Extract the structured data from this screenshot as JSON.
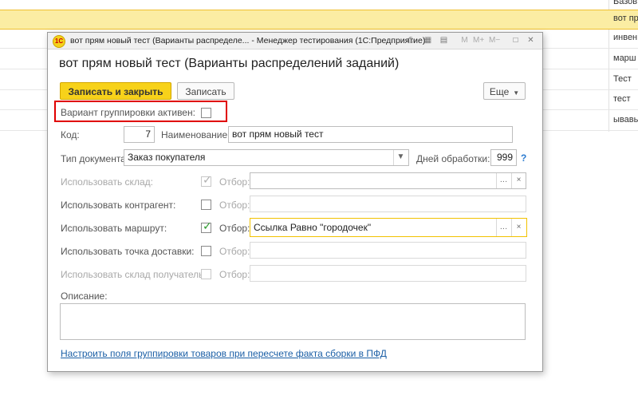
{
  "background_list": {
    "rows": [
      "Базов",
      "вот пр",
      "инвен",
      "марш",
      "Тест",
      "тест",
      "ывавы"
    ]
  },
  "window": {
    "logo_text": "1С",
    "title": "вот прям новый тест (Варианты распределе... - Менеджер тестирования (1С:Предприятие)",
    "form_title": "вот прям новый тест (Варианты распределений заданий)"
  },
  "toolbar": {
    "save_close_label": "Записать и закрыть",
    "save_label": "Записать",
    "more_label": "Еще"
  },
  "form": {
    "grouping_active_label": "Вариант группировки активен:",
    "grouping_active_checked": false,
    "code_label": "Код:",
    "code_value": "7",
    "name_label": "Наименование:",
    "name_value": "вот прям новый тест",
    "doc_type_label": "Тип документа:",
    "doc_type_value": "Заказ покупателя",
    "days_label": "Дней обработки:",
    "days_value": "999",
    "help_label": "?",
    "filter_label": "Отбор:",
    "use_warehouse_label": "Использовать склад:",
    "use_warehouse_checked": true,
    "use_contractor_label": "Использовать контрагент:",
    "use_contractor_checked": false,
    "use_route_label": "Использовать маршрут:",
    "use_route_checked": true,
    "route_filter_value": "Ссылка Равно \"городочек\"",
    "use_delivery_point_label": "Использовать точка доставки:",
    "use_delivery_point_checked": false,
    "use_recipient_warehouse_label": "Использовать склад получатель:",
    "use_recipient_warehouse_checked": false,
    "description_label": "Описание:",
    "description_value": "",
    "link_text": "Настроить поля группировки товаров при пересчете факта сборки в ПФД"
  },
  "colors": {
    "accent_yellow": "#f7d21a",
    "highlight_red": "#e00000",
    "link_blue": "#1b5fa6",
    "check_green": "#2d9a2d"
  }
}
